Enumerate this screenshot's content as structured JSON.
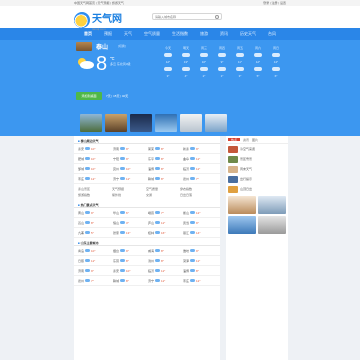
{
  "topbar": {
    "left": "中国天气网首页 | 天气预报 | 旅游天气",
    "right": "登录 | 注册 | 设置"
  },
  "brand": {
    "name": "天气网",
    "tagline": "tianqi.com"
  },
  "search": {
    "placeholder": "请输入城市名称"
  },
  "nav": [
    "首页",
    "预报",
    "天气",
    "空气质量",
    "生活指数",
    "旅游",
    "资讯",
    "历史天气",
    "台风"
  ],
  "hero": {
    "city": "泰山",
    "subcity": "[切换]",
    "temp": "8",
    "unit": "℃",
    "desc": "多云 东北风3级",
    "button": "添加到桌面",
    "quick": "7天 | 15天 | 40天"
  },
  "forecast": {
    "days": [
      "今天",
      "明天",
      "周三",
      "周四",
      "周五",
      "周六",
      "周日"
    ],
    "highs": [
      "12°",
      "13°",
      "10°",
      "9°",
      "11°",
      "12°",
      "14°"
    ],
    "lows": [
      "3°",
      "4°",
      "2°",
      "1°",
      "3°",
      "5°",
      "6°"
    ]
  },
  "sections": [
    {
      "title": "泰山周边天气",
      "rows": [
        [
          {
            "n": "泰安",
            "t": "10°"
          },
          {
            "n": "济南",
            "t": "9°"
          },
          {
            "n": "莱芜",
            "t": "8°"
          },
          {
            "n": "新泰",
            "t": "9°"
          }
        ],
        [
          {
            "n": "肥城",
            "t": "10°"
          },
          {
            "n": "宁阳",
            "t": "9°"
          },
          {
            "n": "东平",
            "t": "8°"
          },
          {
            "n": "曲阜",
            "t": "11°"
          }
        ],
        [
          {
            "n": "邹城",
            "t": "10°"
          },
          {
            "n": "兖州",
            "t": "10°"
          },
          {
            "n": "淄博",
            "t": "8°"
          },
          {
            "n": "临沂",
            "t": "11°"
          }
        ],
        [
          {
            "n": "枣庄",
            "t": "12°"
          },
          {
            "n": "济宁",
            "t": "11°"
          },
          {
            "n": "聊城",
            "t": "8°"
          },
          {
            "n": "德州",
            "t": "7°"
          }
        ]
      ]
    },
    {
      "title": "热门景点天气",
      "rows": [
        [
          {
            "n": "黄山",
            "t": "9°"
          },
          {
            "n": "华山",
            "t": "6°"
          },
          {
            "n": "峨眉",
            "t": "7°"
          },
          {
            "n": "衡山",
            "t": "12°"
          }
        ],
        [
          {
            "n": "嵩山",
            "t": "8°"
          },
          {
            "n": "恒山",
            "t": "3°"
          },
          {
            "n": "庐山",
            "t": "11°"
          },
          {
            "n": "武当",
            "t": "9°"
          }
        ],
        [
          {
            "n": "九寨",
            "t": "5°"
          },
          {
            "n": "张家",
            "t": "13°"
          },
          {
            "n": "桂林",
            "t": "16°"
          },
          {
            "n": "丽江",
            "t": "14°"
          }
        ]
      ]
    },
    {
      "title": "山东主要城市",
      "rows": [
        [
          {
            "n": "青岛",
            "t": "10°"
          },
          {
            "n": "烟台",
            "t": "9°"
          },
          {
            "n": "威海",
            "t": "8°"
          },
          {
            "n": "潍坊",
            "t": "9°"
          }
        ],
        [
          {
            "n": "日照",
            "t": "11°"
          },
          {
            "n": "东营",
            "t": "8°"
          },
          {
            "n": "滨州",
            "t": "8°"
          },
          {
            "n": "菏泽",
            "t": "11°"
          }
        ],
        [
          {
            "n": "济南",
            "t": "9°"
          },
          {
            "n": "泰安",
            "t": "10°"
          },
          {
            "n": "临沂",
            "t": "11°"
          },
          {
            "n": "淄博",
            "t": "8°"
          }
        ],
        [
          {
            "n": "德州",
            "t": "7°"
          },
          {
            "n": "聊城",
            "t": "8°"
          },
          {
            "n": "济宁",
            "t": "11°"
          },
          {
            "n": "枣庄",
            "t": "12°"
          }
        ]
      ]
    }
  ],
  "links": [
    "泰山景区",
    "天气预报",
    "空气质量",
    "穿衣指数",
    "旅游指数",
    "紫外线",
    "交通",
    "日出日落"
  ],
  "sidebar": {
    "tabs": [
      "热点",
      "资讯",
      "图片"
    ],
    "news": [
      "冷空气来袭",
      "景区雪景",
      "周末天气",
      "出行提示",
      "山顶日出"
    ]
  }
}
